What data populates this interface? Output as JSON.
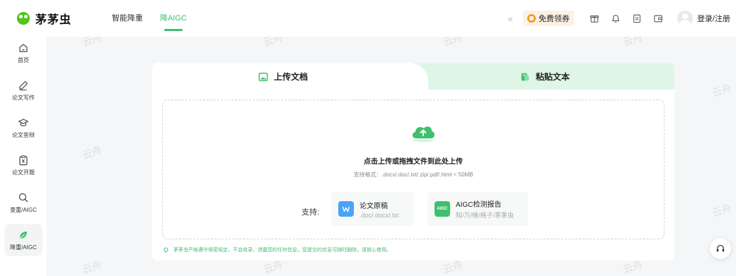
{
  "header": {
    "brand_name": "茅茅虫",
    "nav": [
      "智能降重",
      "降AIGC"
    ],
    "active_nav": "降AIGC",
    "coupon_label": "免费领券",
    "login_label": "登录/注册"
  },
  "sidebar": {
    "items": [
      {
        "label": "首页",
        "icon": "home-icon"
      },
      {
        "label": "论文写作",
        "icon": "pen-icon"
      },
      {
        "label": "论文答辩",
        "icon": "graduation-cap-icon"
      },
      {
        "label": "论文开题",
        "icon": "clipboard-icon"
      },
      {
        "label": "查重/AIGC",
        "icon": "search-icon"
      },
      {
        "label": "降重/AIGC",
        "icon": "leaf-icon"
      }
    ]
  },
  "main": {
    "tabs": [
      {
        "label": "上传文档",
        "icon": "image-upload-icon"
      },
      {
        "label": "粘贴文本",
        "icon": "paste-icon"
      }
    ],
    "upload_title": "点击上传或拖拽文件到此处上传",
    "upload_formats": "支持格式：.docx/.doc/.txt/.zip/.pdf/.html < 50MB",
    "support_label": "支持:",
    "support_cards": [
      {
        "title": "论文原稿",
        "subtitle": ".doc/.docx/.txt",
        "icon_text": ""
      },
      {
        "title": "AIGC检测报告",
        "subtitle": "知/万/维/格子/茅茅虫",
        "icon_text": "AIGC"
      }
    ]
  },
  "notice": "茅茅虫严格遵守保密规定，不会收录、泄露您的任何信息，您提交的信息可随时删除，请放心使用。",
  "watermark": "云舟",
  "colors": {
    "accent": "#3fbf6f",
    "tab_inactive_bg": "#dff6e6",
    "coupon_bg": "#fdf1e3",
    "coupon_icon": "#f39a1f",
    "word_icon": "#4aa3f5",
    "aigc_icon": "#3fbf6f"
  }
}
